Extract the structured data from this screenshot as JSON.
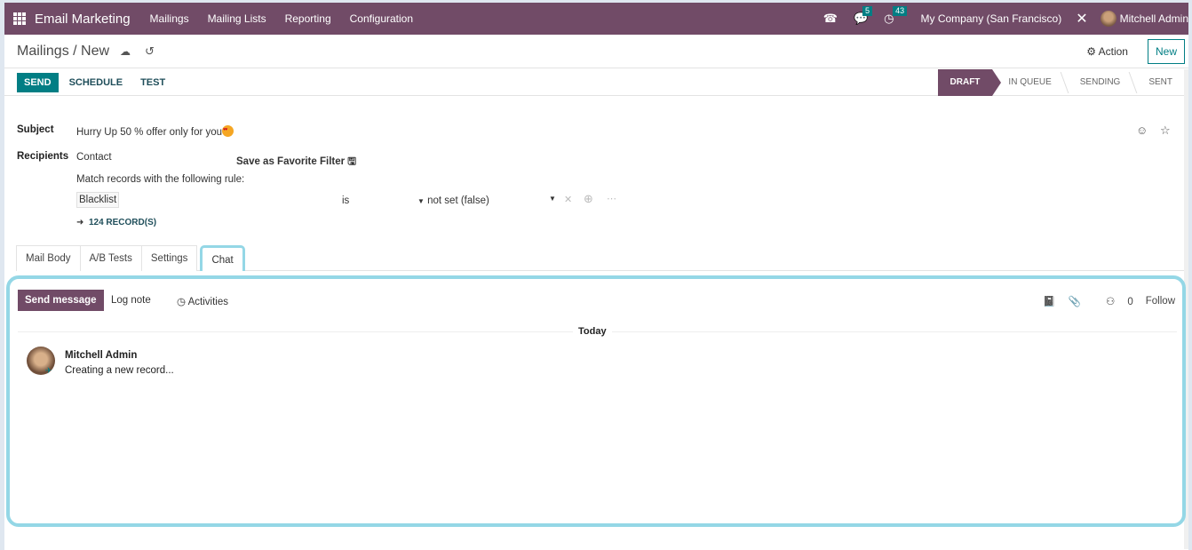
{
  "navbar": {
    "app_name": "Email Marketing",
    "menu": [
      "Mailings",
      "Mailing Lists",
      "Reporting",
      "Configuration"
    ],
    "messages_count": "5",
    "activities_count": "43",
    "company": "My Company (San Francisco)",
    "user": "Mitchell Admin"
  },
  "control_panel": {
    "breadcrumb": "Mailings / New",
    "action_label": "Action",
    "new_label": "New"
  },
  "statusbar": {
    "send_label": "SEND",
    "schedule_label": "SCHEDULE",
    "test_label": "TEST",
    "stages": [
      "DRAFT",
      "IN QUEUE",
      "SENDING",
      "SENT"
    ],
    "active_stage": "DRAFT"
  },
  "form": {
    "subject_label": "Subject",
    "subject_value": "Hurry Up 50 % offer only for you",
    "recipients_label": "Recipients",
    "recipients_model": "Contact",
    "save_favorite_label": "Save as Favorite Filter",
    "rule_intro": "Match records with the following rule:",
    "rule_field": "Blacklist",
    "rule_operator": "is",
    "rule_value": "not set (false)",
    "records_link": "124 RECORD(S)"
  },
  "tabs": [
    "Mail Body",
    "A/B Tests",
    "Settings",
    "Chat"
  ],
  "active_tab": "Chat",
  "chatter": {
    "send_message_label": "Send message",
    "log_note_label": "Log note",
    "activities_label": "Activities",
    "followers_count": "0",
    "follow_label": "Follow",
    "date_separator": "Today",
    "messages": [
      {
        "author": "Mitchell Admin",
        "body": "Creating a new record..."
      }
    ]
  }
}
